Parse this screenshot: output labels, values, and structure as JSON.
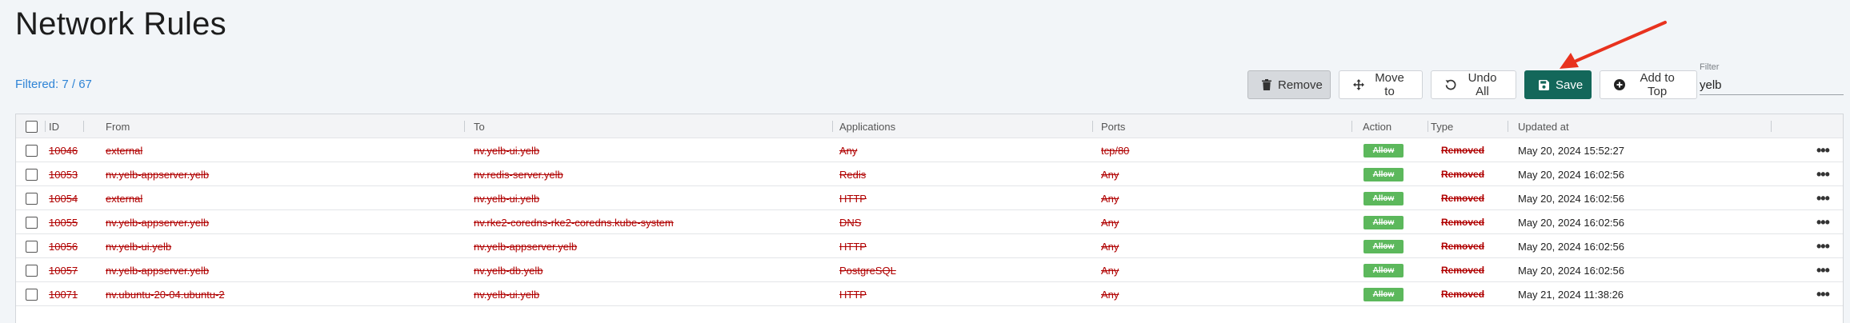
{
  "page": {
    "title": "Network Rules"
  },
  "status": {
    "filtered_text": "Filtered: 7 / 67"
  },
  "toolbar": {
    "remove_label": "Remove",
    "move_label": "Move to",
    "undo_label": "Undo All",
    "save_label": "Save",
    "add_top_label": "Add to Top"
  },
  "filter": {
    "label": "Filter",
    "value": "yelb"
  },
  "table": {
    "headers": {
      "id": "ID",
      "from": "From",
      "to": "To",
      "applications": "Applications",
      "ports": "Ports",
      "action": "Action",
      "type": "Type",
      "updated_at": "Updated at"
    },
    "rows": [
      {
        "id": "10046",
        "from": "external",
        "to": "nv.yelb-ui.yelb",
        "applications": "Any",
        "ports": "tcp/80",
        "action": "Allow",
        "type": "Removed",
        "updated_at": "May 20, 2024 15:52:27"
      },
      {
        "id": "10053",
        "from": "nv.yelb-appserver.yelb",
        "to": "nv.redis-server.yelb",
        "applications": "Redis",
        "ports": "Any",
        "action": "Allow",
        "type": "Removed",
        "updated_at": "May 20, 2024 16:02:56"
      },
      {
        "id": "10054",
        "from": "external",
        "to": "nv.yelb-ui.yelb",
        "applications": "HTTP",
        "ports": "Any",
        "action": "Allow",
        "type": "Removed",
        "updated_at": "May 20, 2024 16:02:56"
      },
      {
        "id": "10055",
        "from": "nv.yelb-appserver.yelb",
        "to": "nv.rke2-coredns-rke2-coredns.kube-system",
        "applications": "DNS",
        "ports": "Any",
        "action": "Allow",
        "type": "Removed",
        "updated_at": "May 20, 2024 16:02:56"
      },
      {
        "id": "10056",
        "from": "nv.yelb-ui.yelb",
        "to": "nv.yelb-appserver.yelb",
        "applications": "HTTP",
        "ports": "Any",
        "action": "Allow",
        "type": "Removed",
        "updated_at": "May 20, 2024 16:02:56"
      },
      {
        "id": "10057",
        "from": "nv.yelb-appserver.yelb",
        "to": "nv.yelb-db.yelb",
        "applications": "PostgreSQL",
        "ports": "Any",
        "action": "Allow",
        "type": "Removed",
        "updated_at": "May 20, 2024 16:02:56"
      },
      {
        "id": "10071",
        "from": "nv.ubuntu-20-04.ubuntu-2",
        "to": "nv.yelb-ui.yelb",
        "applications": "HTTP",
        "ports": "Any",
        "action": "Allow",
        "type": "Removed",
        "updated_at": "May 21, 2024 11:38:26"
      }
    ]
  },
  "colors": {
    "save_bg": "#13675a",
    "filtered_text": "#2f84d6",
    "removed_red": "#b00000",
    "allow_green": "#5cb85c",
    "annotation_arrow": "#e8321e"
  },
  "icons": {
    "remove": "trash-icon",
    "move": "move-arrows-icon",
    "undo": "undo-icon",
    "save": "floppy-disk-icon",
    "add_top": "plus-circle-icon",
    "row_menu": "ellipsis-icon"
  }
}
